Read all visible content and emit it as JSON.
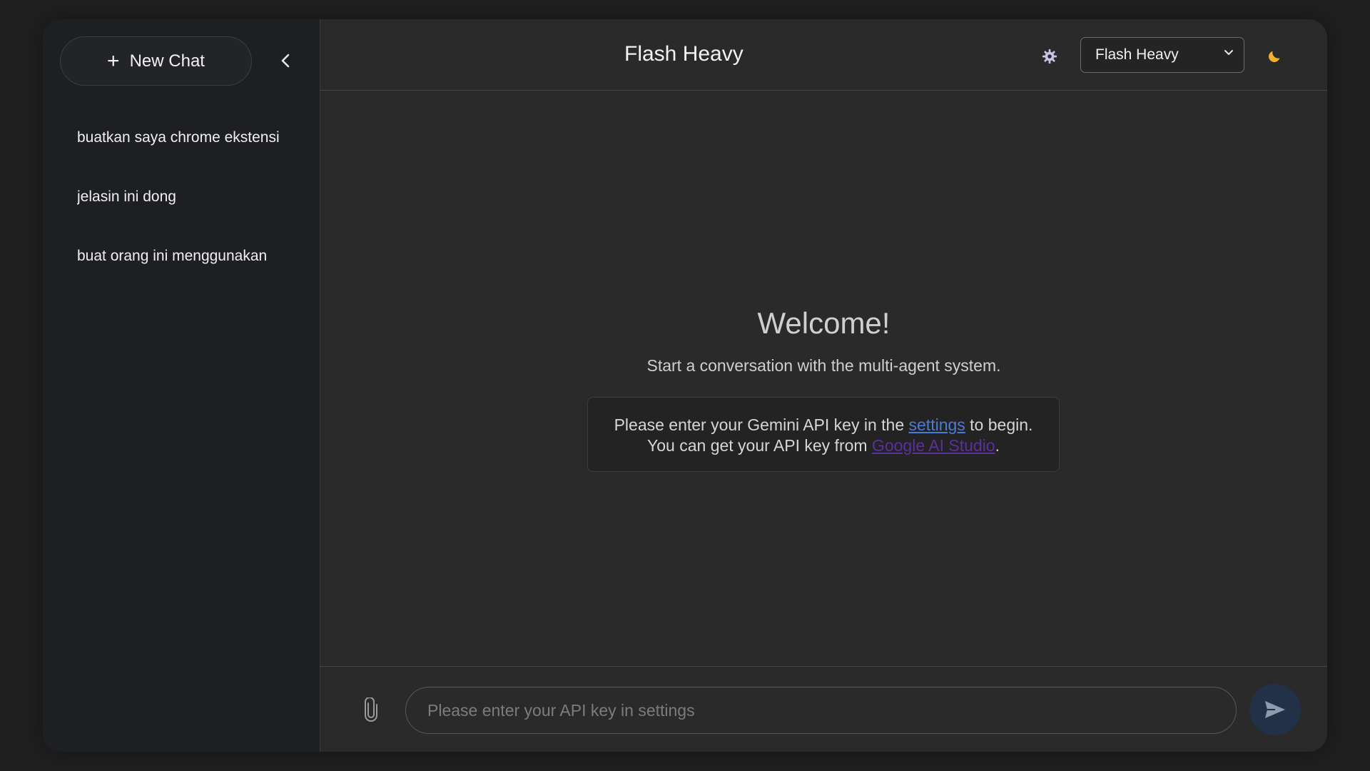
{
  "sidebar": {
    "new_chat_label": "New Chat",
    "history": [
      {
        "title": "buatkan saya chrome ekstensi"
      },
      {
        "title": "jelasin ini dong"
      },
      {
        "title": "buat orang ini menggunakan"
      }
    ]
  },
  "header": {
    "title": "Flash Heavy",
    "model_selected": "Flash Heavy"
  },
  "welcome": {
    "heading": "Welcome!",
    "subtitle": "Start a conversation with the multi-agent system.",
    "notice_prefix": "Please enter your Gemini API key in the ",
    "notice_link": "settings",
    "notice_suffix": " to begin.",
    "notice_line2_prefix": "You can get your API key from ",
    "notice_line2_link": "Google AI Studio",
    "notice_line2_suffix": "."
  },
  "composer": {
    "placeholder": "Please enter your API key in settings",
    "value": ""
  },
  "colors": {
    "background": "#1f1f20",
    "panel": "#2a2a2a",
    "sidebar": "#1e1f22",
    "link": "#4a7bd6",
    "visited_link": "#5b2f9c",
    "send_button": "#223048",
    "moon": "#f0b030"
  },
  "icons": {
    "plus": "plus-icon",
    "collapse": "chevron-left-icon",
    "settings": "gear-icon",
    "dropdown": "chevron-down-icon",
    "theme": "moon-icon",
    "attach": "paperclip-icon",
    "send": "send-icon"
  }
}
